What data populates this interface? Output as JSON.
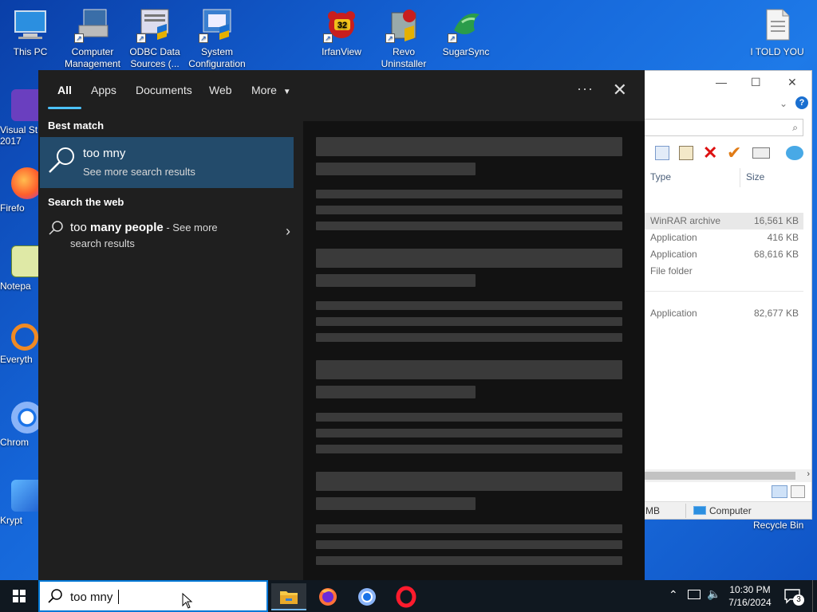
{
  "desktop": {
    "icons_top": [
      {
        "label": "This PC"
      },
      {
        "label": "Computer Management"
      },
      {
        "label": "ODBC Data Sources (..."
      },
      {
        "label": "System Configuration"
      },
      {
        "label": "IrfanView",
        "badge": "32"
      },
      {
        "label": "Revo Uninstaller"
      },
      {
        "label": "SugarSync"
      },
      {
        "label": "I TOLD YOU"
      }
    ],
    "icons_left": [
      {
        "label": "Visual St\n2017"
      },
      {
        "label": "Firefo"
      },
      {
        "label": "Notepa"
      },
      {
        "label": "Everyth"
      },
      {
        "label": "Chrom"
      },
      {
        "label": "Krypt"
      }
    ],
    "recycle_bin": "Recycle Bin"
  },
  "explorer": {
    "col_type": "Type",
    "col_size": "Size",
    "rows": [
      {
        "type": "WinRAR archive",
        "size": "16,561 KB"
      },
      {
        "type": "Application",
        "size": "416 KB"
      },
      {
        "type": "Application",
        "size": "68,616 KB"
      },
      {
        "type": "File folder",
        "size": ""
      },
      {
        "type": "Application",
        "size": "82,677 KB"
      }
    ],
    "status_left": "MB",
    "status_right": "Computer"
  },
  "search_panel": {
    "tabs": [
      "All",
      "Apps",
      "Documents",
      "Web",
      "More"
    ],
    "more_dots": "···",
    "close": "✕",
    "best_match_label": "Best match",
    "best_match_title": "too mny",
    "best_match_sub": "See more search results",
    "web_label": "Search the web",
    "web_query_prefix": "too ",
    "web_query_bold": "many people",
    "web_query_suffix": " - See more",
    "web_query_line2": "search results"
  },
  "taskbar": {
    "search_text": "too mny",
    "time": "10:30 PM",
    "date": "7/16/2024",
    "notifications": "3"
  },
  "colors": {
    "accent": "#4cc2ff",
    "selection": "#234b6b",
    "taskbar": "#101820"
  }
}
